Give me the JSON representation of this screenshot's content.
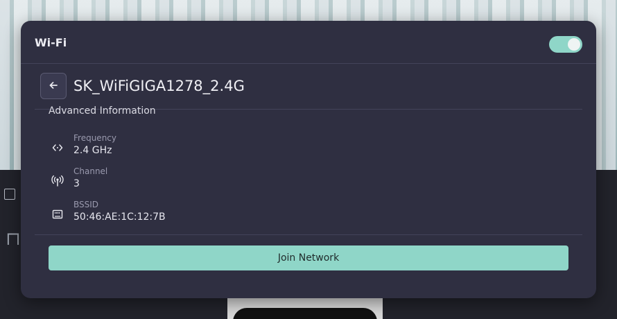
{
  "panel": {
    "title": "Wi-Fi",
    "wifi_enabled": true,
    "accent_color": "#8fd6c8"
  },
  "network": {
    "name": "SK_WiFiGIGA1278_2.4G",
    "back_icon": "arrow-left-icon"
  },
  "advanced": {
    "section_title": "Advanced Information",
    "items": [
      {
        "label": "Frequency",
        "value": "2.4 GHz",
        "icon": "frequency-icon"
      },
      {
        "label": "Channel",
        "value": "3",
        "icon": "antenna-icon"
      },
      {
        "label": "BSSID",
        "value": "50:46:AE:1C:12:7B",
        "icon": "ethernet-port-icon"
      }
    ]
  },
  "actions": {
    "join_label": "Join Network"
  }
}
